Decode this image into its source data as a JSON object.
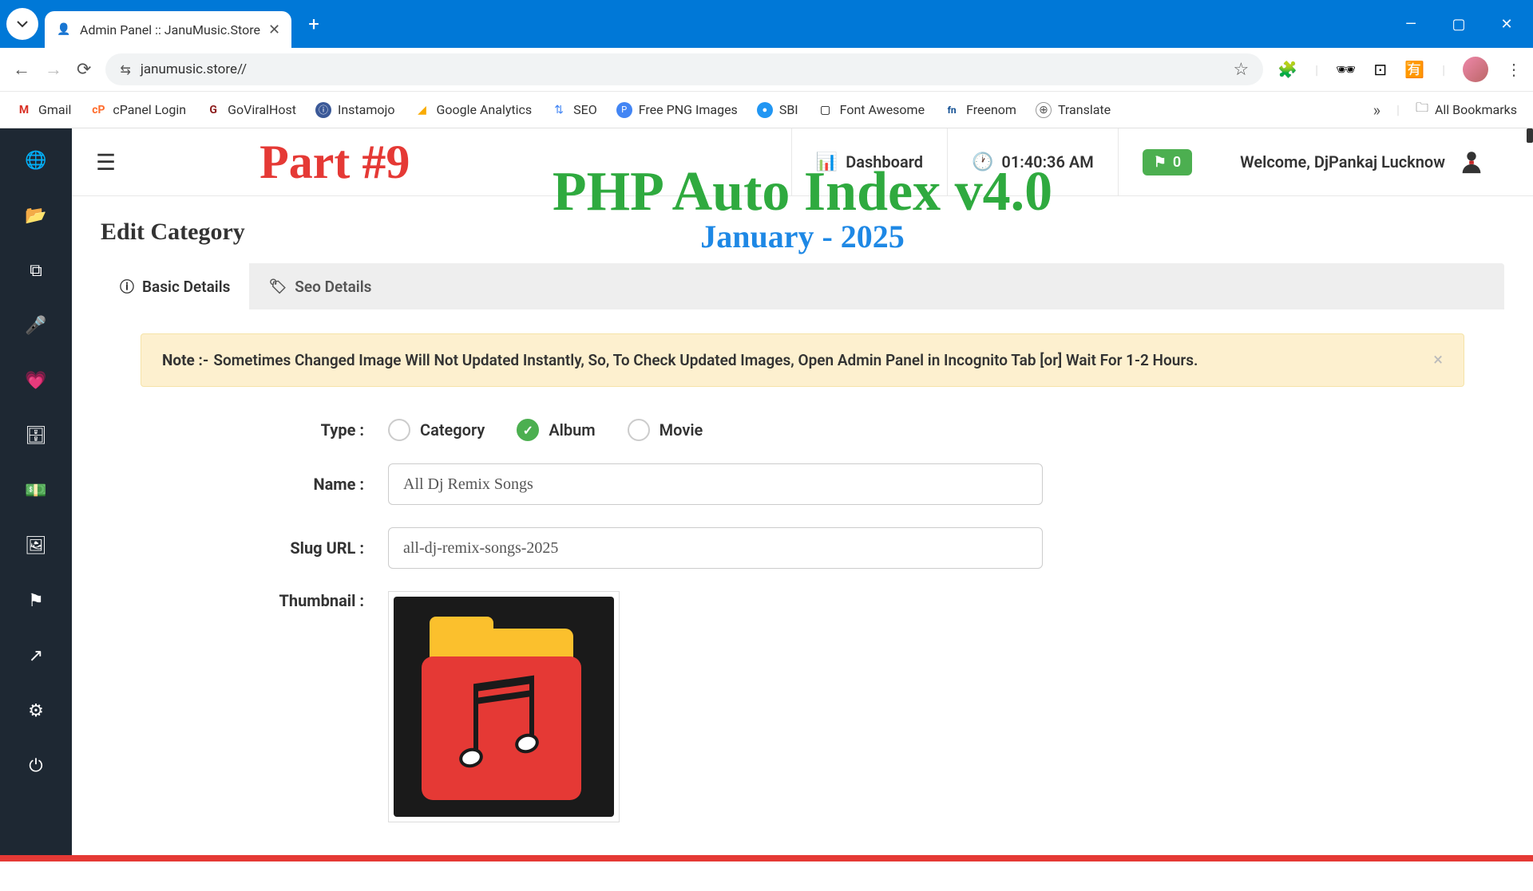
{
  "browser": {
    "tab_title": "Admin Panel :: JanuMusic.Store",
    "url": "janumusic.store//"
  },
  "bookmarks": [
    {
      "label": "Gmail",
      "icon_class": "bm-gmail",
      "glyph": "M"
    },
    {
      "label": "cPanel Login",
      "icon_class": "bm-cp",
      "glyph": "cP"
    },
    {
      "label": "GoViralHost",
      "icon_class": "bm-gv",
      "glyph": "G"
    },
    {
      "label": "Instamojo",
      "icon_class": "bm-im",
      "glyph": "ⓘ"
    },
    {
      "label": "Google Analytics",
      "icon_class": "bm-ga",
      "glyph": "◢"
    },
    {
      "label": "SEO",
      "icon_class": "bm-seo",
      "glyph": "⇅"
    },
    {
      "label": "Free PNG Images",
      "icon_class": "bm-png",
      "glyph": "P"
    },
    {
      "label": "SBI",
      "icon_class": "bm-sbi",
      "glyph": "●"
    },
    {
      "label": "Font Awesome",
      "icon_class": "bm-fa",
      "glyph": "▢"
    },
    {
      "label": "Freenom",
      "icon_class": "bm-fn",
      "glyph": "fn"
    },
    {
      "label": "Translate",
      "icon_class": "bm-tr",
      "glyph": "⊕"
    }
  ],
  "all_bookmarks_label": "All Bookmarks",
  "overlay": {
    "part": "Part #9",
    "title": "PHP Auto Index v4.0",
    "date": "January - 2025"
  },
  "topbar": {
    "dashboard": "Dashboard",
    "time": "01:40:36 AM",
    "flag_count": "0",
    "welcome": "Welcome, DjPankaj Lucknow"
  },
  "page": {
    "heading": "Edit Category",
    "tabs": {
      "basic": "Basic Details",
      "seo": "Seo Details"
    },
    "alert": {
      "note": "Note :-",
      "text": "Sometimes Changed Image Will Not Updated Instantly, So, To Check Updated Images, Open Admin Panel in Incognito Tab [or] Wait For 1-2 Hours."
    },
    "form": {
      "type_label": "Type :",
      "type_options": {
        "category": "Category",
        "album": "Album",
        "movie": "Movie"
      },
      "type_selected": "album",
      "name_label": "Name :",
      "name_value": "All Dj Remix Songs",
      "slug_label": "Slug URL :",
      "slug_value": "all-dj-remix-songs-2025",
      "thumbnail_label": "Thumbnail :"
    }
  }
}
